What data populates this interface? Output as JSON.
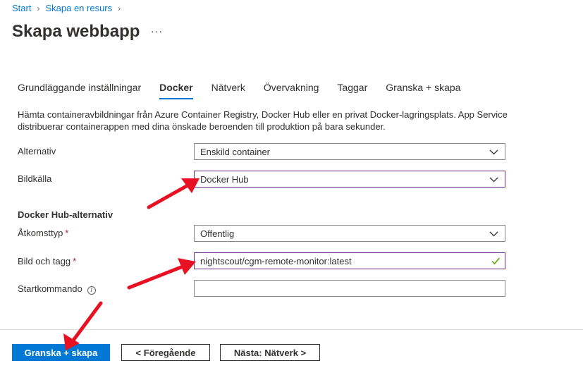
{
  "breadcrumb": {
    "items": [
      "Start",
      "Skapa en resurs"
    ]
  },
  "title": "Skapa webbapp",
  "more_label": "···",
  "tabs": [
    {
      "label": "Grundläggande inställningar",
      "active": false
    },
    {
      "label": "Docker",
      "active": true
    },
    {
      "label": "Nätverk",
      "active": false
    },
    {
      "label": "Övervakning",
      "active": false
    },
    {
      "label": "Taggar",
      "active": false
    },
    {
      "label": "Granska + skapa",
      "active": false
    }
  ],
  "description": "Hämta containeravbildningar från Azure Container Registry, Docker Hub eller en privat Docker-lagringsplats. App Service distribuerar containerappen med dina önskade beroenden till produktion på bara sekunder.",
  "form": {
    "alternativ": {
      "label": "Alternativ",
      "value": "Enskild container"
    },
    "bildkalla": {
      "label": "Bildkälla",
      "value": "Docker Hub"
    },
    "section_heading": "Docker Hub-alternativ",
    "atkomsttyp": {
      "label": "Åtkomsttyp",
      "required_mark": "*",
      "value": "Offentlig"
    },
    "bild_tagg": {
      "label": "Bild och tagg",
      "required_mark": "*",
      "value": "nightscout/cgm-remote-monitor:latest"
    },
    "startkommando": {
      "label": "Startkommando",
      "info_glyph": "i",
      "value": ""
    }
  },
  "footer": {
    "review_create": "Granska + skapa",
    "previous": "< Föregående",
    "next": "Nästa: Nätverk >"
  },
  "colors": {
    "accent": "#0078d4",
    "annotation_arrow": "#e81123",
    "valid_check": "#57a300",
    "focus_border": "#6b2f8a"
  },
  "icons": [
    "chevron-right-icon",
    "more-icon",
    "chevron-down-icon",
    "checkmark-icon",
    "info-icon",
    "annotation-arrow"
  ]
}
